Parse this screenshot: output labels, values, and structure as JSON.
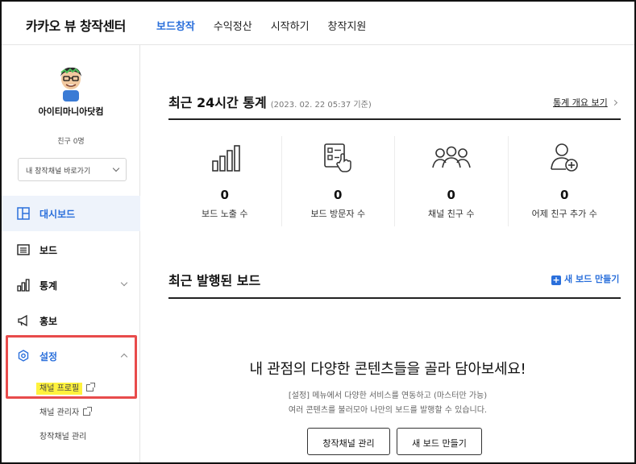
{
  "header": {
    "brand": "카카오 뷰 창작센터",
    "nav": [
      "보드창작",
      "수익정산",
      "시작하기",
      "창작지원"
    ]
  },
  "sidebar": {
    "profile_name": "아이티마니아닷컴",
    "friends": "친구 0명",
    "channel_select": "내 창작채널 바로가기",
    "menu": [
      {
        "label": "대시보드",
        "icon": "dashboard-icon"
      },
      {
        "label": "보드",
        "icon": "board-icon"
      },
      {
        "label": "통계",
        "icon": "stats-icon"
      },
      {
        "label": "홍보",
        "icon": "megaphone-icon"
      },
      {
        "label": "설정",
        "icon": "gear-icon"
      }
    ],
    "sub": [
      "채널 프로필",
      "채널 관리자",
      "창작채널 관리"
    ]
  },
  "stats_section": {
    "title": "최근 24시간 통계",
    "subtitle": "(2023. 02. 22 05:37 기준)",
    "overview_link": "통계 개요 보기",
    "items": [
      {
        "value": "0",
        "label": "보드 노출 수",
        "icon": "bar-chart-icon"
      },
      {
        "value": "0",
        "label": "보드 방문자 수",
        "icon": "tap-board-icon"
      },
      {
        "value": "0",
        "label": "채널 친구 수",
        "icon": "people-icon"
      },
      {
        "value": "0",
        "label": "어제 친구 추가 수",
        "icon": "add-user-icon"
      }
    ]
  },
  "boards_section": {
    "title": "최근 발행된 보드",
    "new_board_link": "새 보드 만들기",
    "empty_title": "내 관점의 다양한 콘텐츠들을 골라 담아보세요!",
    "empty_desc_1": "[설정] 메뉴에서 다양한 서비스를 연동하고 (마스터만 가능)",
    "empty_desc_2": "여러 콘텐츠를 불러모아 나만의 보드를 발행할 수 있습니다.",
    "btn_manage": "창작채널 관리",
    "btn_new": "새 보드 만들기"
  },
  "colors": {
    "accent": "#2a6fdb",
    "highlight": "#fff23d",
    "annotation_box": "#e84b4b"
  }
}
